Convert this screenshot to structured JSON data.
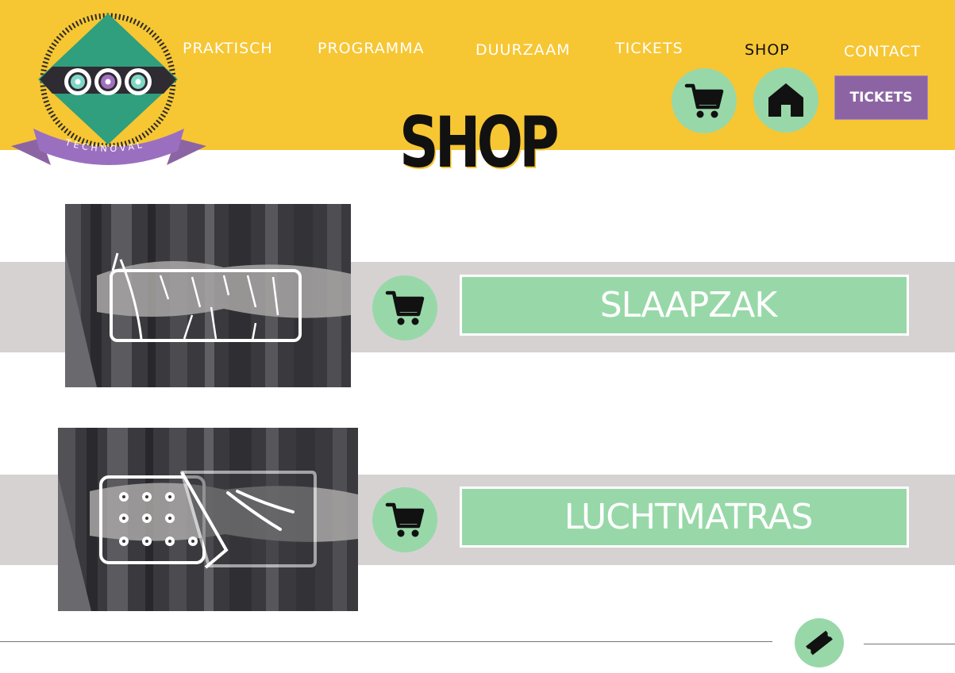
{
  "brand": {
    "logo_text": "TECHNOVAL"
  },
  "nav": {
    "items": [
      {
        "label": "PRAKTISCH"
      },
      {
        "label": "PROGRAMMA"
      },
      {
        "label": "DUURZAAM"
      },
      {
        "label": "TICKETS"
      },
      {
        "label": "SHOP",
        "active": true
      },
      {
        "label": "CONTACT"
      }
    ]
  },
  "header_actions": {
    "cart_icon": "shopping-cart-icon",
    "home_icon": "home-icon",
    "tickets_label": "TICKETS"
  },
  "page": {
    "title": "SHOP"
  },
  "products": [
    {
      "name": "SLAAPZAK",
      "image_icon": "sleeping-bag-sketch",
      "cart_icon": "shopping-cart-icon"
    },
    {
      "name": "LUCHTMATRAS",
      "image_icon": "air-mattress-sketch",
      "cart_icon": "shopping-cart-icon"
    }
  ],
  "footer": {
    "ticket_icon": "ticket-icon"
  },
  "colors": {
    "header_yellow": "#f7c633",
    "mint": "#98d8a8",
    "purple": "#8d64a3",
    "band_grey": "#d6d2d2",
    "logo_teal": "#2f9f7e"
  }
}
